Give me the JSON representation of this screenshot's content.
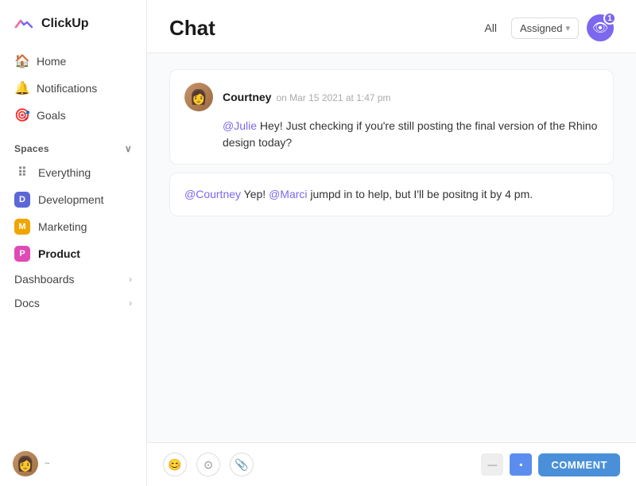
{
  "app": {
    "name": "ClickUp"
  },
  "sidebar": {
    "nav": [
      {
        "id": "home",
        "label": "Home",
        "icon": "🏠"
      },
      {
        "id": "notifications",
        "label": "Notifications",
        "icon": "🔔"
      },
      {
        "id": "goals",
        "label": "Goals",
        "icon": "🎯"
      }
    ],
    "spaces_label": "Spaces",
    "spaces": [
      {
        "id": "everything",
        "label": "Everything",
        "type": "grid"
      },
      {
        "id": "development",
        "label": "Development",
        "type": "dev",
        "initial": "D"
      },
      {
        "id": "marketing",
        "label": "Marketing",
        "type": "mkt",
        "initial": "M"
      },
      {
        "id": "product",
        "label": "Product",
        "type": "prod",
        "initial": "P",
        "active": true
      }
    ],
    "sections": [
      {
        "id": "dashboards",
        "label": "Dashboards"
      },
      {
        "id": "docs",
        "label": "Docs"
      }
    ]
  },
  "header": {
    "title": "Chat",
    "filter_all": "All",
    "filter_assigned": "Assigned",
    "badge_count": "1"
  },
  "messages": [
    {
      "id": "msg1",
      "author": "Courtney",
      "timestamp": "on Mar 15 2021 at 1:47 pm",
      "body_parts": [
        {
          "type": "mention",
          "text": "@Julie"
        },
        {
          "type": "text",
          "text": " Hey! Just checking if you're still posting the final version of the Rhino design today?"
        }
      ]
    }
  ],
  "reply": {
    "body_parts": [
      {
        "type": "mention",
        "text": "@Courtney"
      },
      {
        "type": "text",
        "text": " Yep! "
      },
      {
        "type": "mention",
        "text": "@Marci"
      },
      {
        "type": "text",
        "text": " jumpd in to help, but I'll be positng it by 4 pm."
      }
    ]
  },
  "compose": {
    "icons": [
      {
        "id": "emoji-icon",
        "symbol": "😊"
      },
      {
        "id": "circle-icon",
        "symbol": "⊙"
      },
      {
        "id": "attach-icon",
        "symbol": "📎"
      }
    ],
    "comment_label": "COMMENT"
  }
}
